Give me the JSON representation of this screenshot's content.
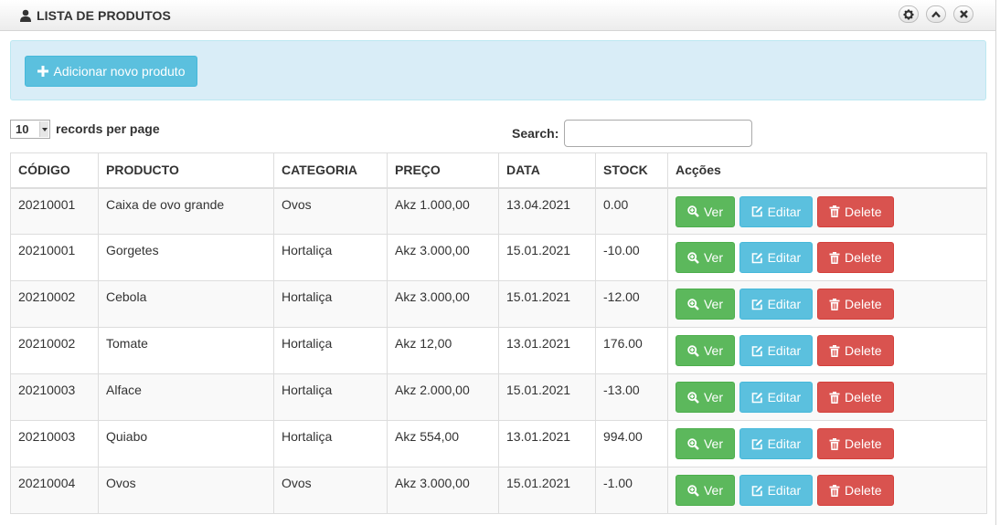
{
  "header": {
    "title": "LISTA DE PRODUTOS",
    "icons": [
      "user-icon",
      "gear-icon",
      "chevron-up-icon",
      "close-icon"
    ]
  },
  "toolbar": {
    "add_label": "Adicionar novo produto"
  },
  "length_menu": {
    "value": "10",
    "label": "records per page"
  },
  "search": {
    "label": "Search:",
    "value": ""
  },
  "table": {
    "columns": [
      "CÓDIGO",
      "PRODUCTO",
      "CATEGORIA",
      "PREÇO",
      "DATA",
      "STOCK",
      "Acções"
    ],
    "rows": [
      {
        "codigo": "20210001",
        "produto": "Caixa de ovo grande",
        "categoria": "Ovos",
        "preco": "Akz 1.000,00",
        "data": "13.04.2021",
        "stock": "0.00"
      },
      {
        "codigo": "20210001",
        "produto": "Gorgetes",
        "categoria": "Hortaliça",
        "preco": "Akz 3.000,00",
        "data": "15.01.2021",
        "stock": "-10.00"
      },
      {
        "codigo": "20210002",
        "produto": "Cebola",
        "categoria": "Hortaliça",
        "preco": "Akz 3.000,00",
        "data": "15.01.2021",
        "stock": "-12.00"
      },
      {
        "codigo": "20210002",
        "produto": "Tomate",
        "categoria": "Hortaliça",
        "preco": "Akz 12,00",
        "data": "13.01.2021",
        "stock": "176.00"
      },
      {
        "codigo": "20210003",
        "produto": "Alface",
        "categoria": "Hortaliça",
        "preco": "Akz 2.000,00",
        "data": "15.01.2021",
        "stock": "-13.00"
      },
      {
        "codigo": "20210003",
        "produto": "Quiabo",
        "categoria": "Hortaliça",
        "preco": "Akz 554,00",
        "data": "13.01.2021",
        "stock": "994.00"
      },
      {
        "codigo": "20210004",
        "produto": "Ovos",
        "categoria": "Ovos",
        "preco": "Akz 3.000,00",
        "data": "15.01.2021",
        "stock": "-1.00"
      }
    ],
    "actions": {
      "ver": "Ver",
      "editar": "Editar",
      "delete": "Delete"
    }
  },
  "colors": {
    "header_bg": "#f2f2f2",
    "alert_bg": "#d9edf7",
    "info": "#5bc0de",
    "success": "#5cb85c",
    "danger": "#d9534f",
    "row_stripe": "#f9f9f9"
  }
}
